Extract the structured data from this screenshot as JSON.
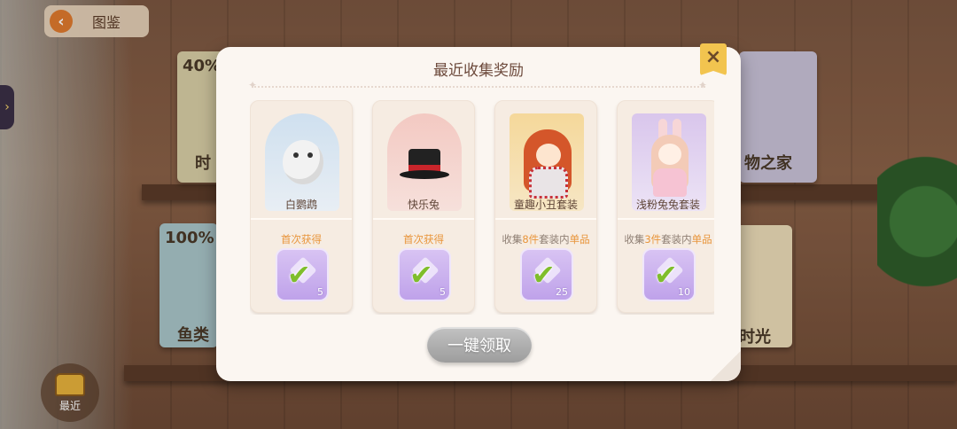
{
  "background": {
    "back_button_label": "图鉴",
    "recent_button_label": "最近",
    "books": [
      {
        "label": "时",
        "percent": "40%"
      },
      {
        "label": "鱼类",
        "percent": "100%"
      },
      {
        "label": "物之家",
        "percent": ""
      },
      {
        "label": "时光",
        "percent": ""
      }
    ]
  },
  "dialog": {
    "title": "最近收集奖励",
    "claim_all_label": "一键领取",
    "cards": [
      {
        "name": "白鹦鹉",
        "status_text": "首次获得",
        "reward_count": "5",
        "icon": "white-parrot-figure"
      },
      {
        "name": "快乐兔",
        "status_text": "首次获得",
        "reward_count": "5",
        "icon": "top-hat-figure"
      },
      {
        "name": "童趣小丑套装",
        "status_prefix": "收集",
        "status_count": "8件",
        "status_mid": "套装内",
        "status_suffix": "单品",
        "reward_count": "25",
        "icon": "clown-outfit-figure"
      },
      {
        "name": "浅粉兔兔套装",
        "status_prefix": "收集",
        "status_count": "3件",
        "status_mid": "套装内",
        "status_suffix": "单品",
        "reward_count": "10",
        "icon": "pink-bunny-outfit-figure"
      }
    ]
  },
  "colors": {
    "accent_orange": "#e8953b",
    "check_green": "#7fbe2b",
    "reward_purple": "#bfa2ea",
    "close_yellow": "#f2c44f"
  }
}
